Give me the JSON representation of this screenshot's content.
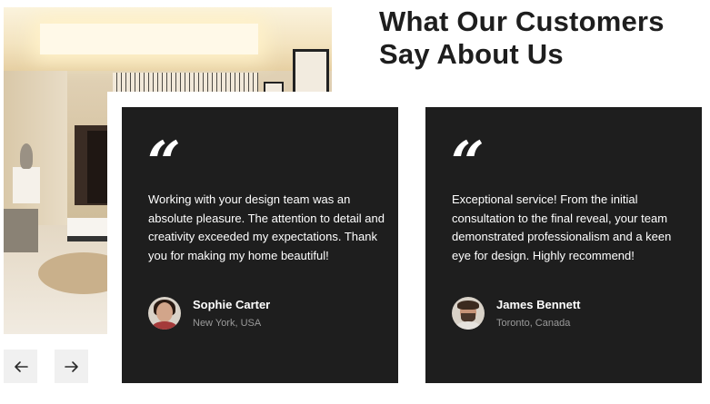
{
  "heading": {
    "line1": "What Our Customers",
    "line2": "Say About Us"
  },
  "photo": {
    "icon": "living-room-photo"
  },
  "testimonials": [
    {
      "quote_icon": "“",
      "text": "Working with your design team was an absolute pleasure. The attention to detail and creativity exceeded my expectations. Thank you for making my home beautiful!",
      "name": "Sophie Carter",
      "location": "New York, USA"
    },
    {
      "quote_icon": "“",
      "text": "Exceptional service! From the initial consultation to the final reveal, your team demonstrated professionalism and a keen eye for design. Highly recommend!",
      "name": "James Bennett",
      "location": "Toronto, Canada"
    }
  ],
  "nav": {
    "prev_icon": "arrow-left-icon",
    "next_icon": "arrow-right-icon"
  },
  "colors": {
    "card_bg": "#1e1e1e",
    "heading": "#1e1e1e",
    "button_bg": "#f0f0f0",
    "muted_text": "#9a9a9a"
  }
}
